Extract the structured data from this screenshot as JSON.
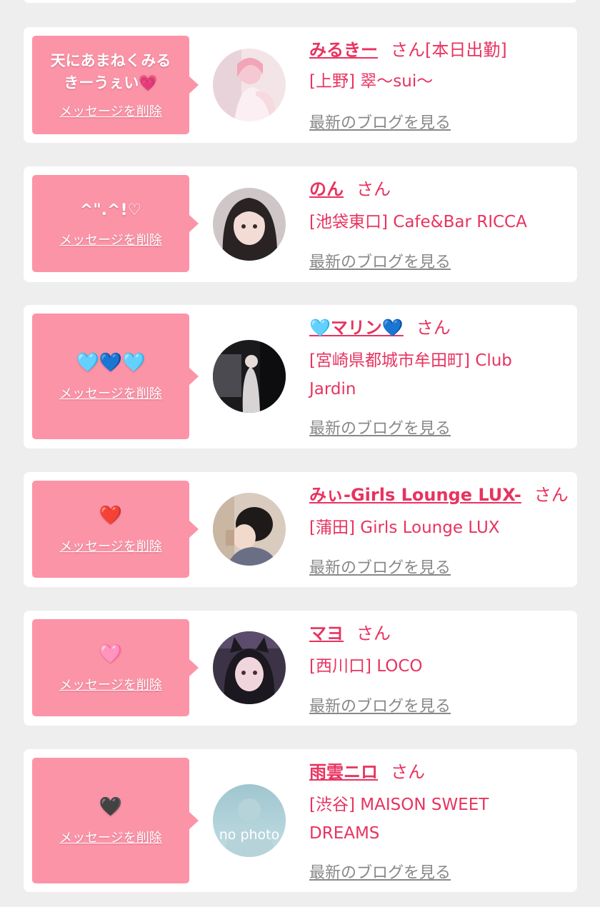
{
  "entries": [
    {
      "message": "天にあまねくみる\nきーうぇい💗",
      "delete_label": "メッセージを削除",
      "name": "みるきー",
      "honorific": "さん[本日出勤]",
      "shop": "[上野] 翠〜sui〜",
      "blog_label": "最新のブログを見る",
      "avatar_icon": "profile-photo"
    },
    {
      "message": "^\".^!♡",
      "delete_label": "メッセージを削除",
      "name": "のん",
      "honorific": "さん",
      "shop": "[池袋東口] Cafe&Bar RICCA",
      "blog_label": "最新のブログを見る",
      "avatar_icon": "profile-photo"
    },
    {
      "message": "🩵💙🩵",
      "delete_label": "メッセージを削除",
      "name": "🩵マリン💙",
      "honorific": "さん",
      "shop": "[宮崎県都城市牟田町] Club Jardin",
      "blog_label": "最新のブログを見る",
      "avatar_icon": "profile-photo"
    },
    {
      "message": "❤️",
      "delete_label": "メッセージを削除",
      "name": "みぃ-Girls Lounge LUX-",
      "honorific": "さん",
      "shop": "[蒲田] Girls Lounge LUX",
      "blog_label": "最新のブログを見る",
      "avatar_icon": "profile-photo"
    },
    {
      "message": "🩷",
      "delete_label": "メッセージを削除",
      "name": "マヨ",
      "honorific": "さん",
      "shop": "[西川口] LOCO",
      "blog_label": "最新のブログを見る",
      "avatar_icon": "profile-photo"
    },
    {
      "message": "🖤",
      "delete_label": "メッセージを削除",
      "name": "雨雲ニロ",
      "honorific": "さん",
      "shop": "[渋谷] MAISON SWEET DREAMS",
      "blog_label": "最新のブログを見る",
      "avatar_icon": "no-photo-placeholder",
      "avatar_text": "no photo"
    }
  ],
  "colors": {
    "accent": "#e8335f",
    "bubble": "#fc94a8",
    "background": "#eeeeee",
    "link_gray": "#888888"
  }
}
